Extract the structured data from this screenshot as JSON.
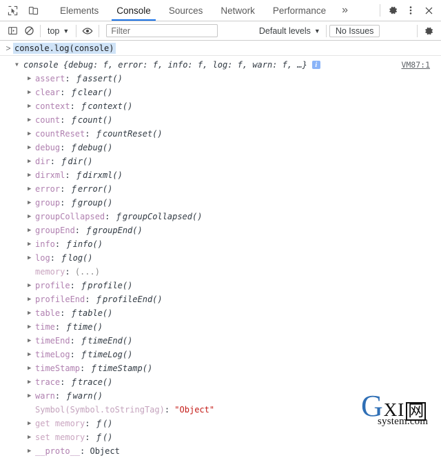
{
  "tabbar": {
    "inspect_icon": "inspect-cursor-icon",
    "device_icon": "device-toolbar-icon",
    "tabs": [
      {
        "label": "Elements",
        "active": false
      },
      {
        "label": "Console",
        "active": true
      },
      {
        "label": "Sources",
        "active": false
      },
      {
        "label": "Network",
        "active": false
      },
      {
        "label": "Performance",
        "active": false
      }
    ],
    "more_label": "»",
    "settings_icon": "gear-icon",
    "menu_icon": "kebab-menu-icon",
    "close_icon": "close-icon"
  },
  "filterbar": {
    "sidebar_icon": "console-sidebar-icon",
    "clear_icon": "clear-console-icon",
    "context": "top",
    "context_caret": "▼",
    "eye_icon": "live-expression-eye-icon",
    "filter_placeholder": "Filter",
    "filter_value": "",
    "levels_label": "Default levels",
    "levels_caret": "▼",
    "issues_label": "No Issues",
    "settings_icon": "console-settings-gear-icon"
  },
  "prompt": {
    "caret": ">",
    "text": "console.log(console)"
  },
  "result": {
    "expand_arrow": "▼",
    "preview": "console {debug: f, error: f, info: f, log: f, warn: f, …}",
    "info_badge": "i",
    "source_link": "VM87:1",
    "properties": [
      {
        "arrow": "▶",
        "name": "assert",
        "value": "assert()",
        "kind": "fn"
      },
      {
        "arrow": "▶",
        "name": "clear",
        "value": "clear()",
        "kind": "fn"
      },
      {
        "arrow": "▶",
        "name": "context",
        "value": "context()",
        "kind": "fn"
      },
      {
        "arrow": "▶",
        "name": "count",
        "value": "count()",
        "kind": "fn"
      },
      {
        "arrow": "▶",
        "name": "countReset",
        "value": "countReset()",
        "kind": "fn"
      },
      {
        "arrow": "▶",
        "name": "debug",
        "value": "debug()",
        "kind": "fn"
      },
      {
        "arrow": "▶",
        "name": "dir",
        "value": "dir()",
        "kind": "fn"
      },
      {
        "arrow": "▶",
        "name": "dirxml",
        "value": "dirxml()",
        "kind": "fn"
      },
      {
        "arrow": "▶",
        "name": "error",
        "value": "error()",
        "kind": "fn"
      },
      {
        "arrow": "▶",
        "name": "group",
        "value": "group()",
        "kind": "fn"
      },
      {
        "arrow": "▶",
        "name": "groupCollapsed",
        "value": "groupCollapsed()",
        "kind": "fn"
      },
      {
        "arrow": "▶",
        "name": "groupEnd",
        "value": "groupEnd()",
        "kind": "fn"
      },
      {
        "arrow": "▶",
        "name": "info",
        "value": "info()",
        "kind": "fn"
      },
      {
        "arrow": "▶",
        "name": "log",
        "value": "log()",
        "kind": "fn"
      },
      {
        "arrow": "",
        "name": "memory",
        "value": "(...)",
        "kind": "lazy"
      },
      {
        "arrow": "▶",
        "name": "profile",
        "value": "profile()",
        "kind": "fn"
      },
      {
        "arrow": "▶",
        "name": "profileEnd",
        "value": "profileEnd()",
        "kind": "fn"
      },
      {
        "arrow": "▶",
        "name": "table",
        "value": "table()",
        "kind": "fn"
      },
      {
        "arrow": "▶",
        "name": "time",
        "value": "time()",
        "kind": "fn"
      },
      {
        "arrow": "▶",
        "name": "timeEnd",
        "value": "timeEnd()",
        "kind": "fn"
      },
      {
        "arrow": "▶",
        "name": "timeLog",
        "value": "timeLog()",
        "kind": "fn"
      },
      {
        "arrow": "▶",
        "name": "timeStamp",
        "value": "timeStamp()",
        "kind": "fn"
      },
      {
        "arrow": "▶",
        "name": "trace",
        "value": "trace()",
        "kind": "fn"
      },
      {
        "arrow": "▶",
        "name": "warn",
        "value": "warn()",
        "kind": "fn"
      },
      {
        "arrow": "",
        "name": "Symbol(Symbol.toStringTag)",
        "value": "\"Object\"",
        "kind": "string"
      },
      {
        "arrow": "▶",
        "name": "get memory",
        "value": "()",
        "kind": "accessor"
      },
      {
        "arrow": "▶",
        "name": "set memory",
        "value": "()",
        "kind": "accessor"
      },
      {
        "arrow": "▶",
        "name": "__proto__",
        "value": "Object",
        "kind": "object"
      }
    ]
  },
  "watermark": {
    "g": "G",
    "xi": "XI",
    "cjk": "网",
    "domain": "system.com"
  },
  "colors": {
    "accent": "#1a73e8",
    "property_name": "#b080b0",
    "string_value": "#c41a16",
    "badge": "#8ab4f8"
  }
}
